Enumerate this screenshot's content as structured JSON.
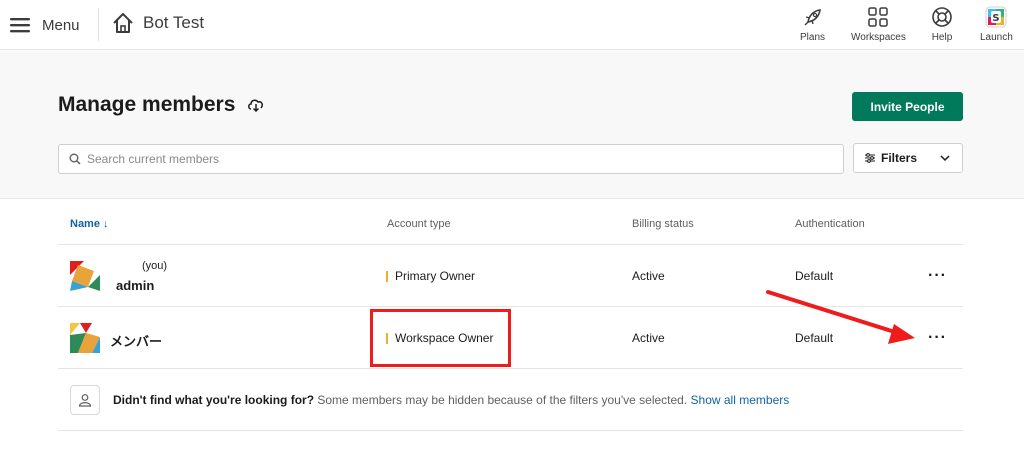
{
  "topbar": {
    "menu_label": "Menu",
    "workspace_name": "Bot Test",
    "nav": [
      {
        "label": "Plans",
        "icon": "rocket-icon"
      },
      {
        "label": "Workspaces",
        "icon": "grid-icon"
      },
      {
        "label": "Help",
        "icon": "lifebuoy-icon"
      },
      {
        "label": "Launch",
        "icon": "slack-app-icon"
      }
    ]
  },
  "header": {
    "title": "Manage members",
    "invite_label": "Invite People",
    "search_placeholder": "Search current members",
    "filters_label": "Filters"
  },
  "table": {
    "columns": {
      "name": "Name ↓",
      "account_type": "Account type",
      "billing": "Billing status",
      "auth": "Authentication"
    },
    "rows": [
      {
        "name": "admin",
        "tag": "(you)",
        "account_type": "Primary Owner",
        "billing": "Active",
        "auth": "Default",
        "more": "···"
      },
      {
        "name": "メンバー",
        "tag": "",
        "account_type": "Workspace Owner",
        "billing": "Active",
        "auth": "Default",
        "more": "···"
      }
    ],
    "hint": {
      "bold": "Didn't find what you're looking for?",
      "text": " Some members may be hidden because of the filters you've selected. ",
      "link": "Show all members"
    }
  },
  "colors": {
    "accent": "#007a5a",
    "link": "#1264a3",
    "owner_bar": "#ecb22e",
    "annotation": "#ee1c1c"
  }
}
